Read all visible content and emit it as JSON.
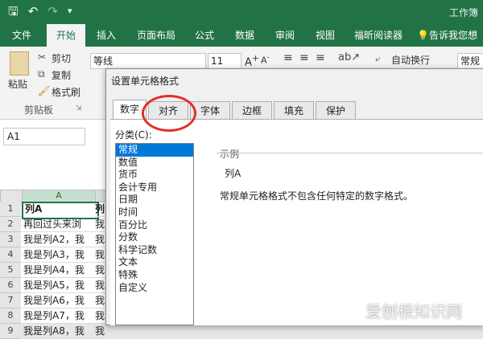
{
  "quick_access": {
    "save": "🖫",
    "undo": "↶",
    "redo": "↷",
    "more": "▾"
  },
  "window_title": "工作簿",
  "ribbon_tabs": [
    "文件",
    "开始",
    "插入",
    "页面布局",
    "公式",
    "数据",
    "审阅",
    "视图",
    "福昕阅读器",
    "告诉我您想"
  ],
  "active_tab": "开始",
  "ribbon": {
    "paste_label": "粘贴",
    "cut_label": "剪切",
    "copy_label": "复制",
    "format_painter_label": "格式刷",
    "clipboard_group": "剪贴板",
    "font_name": "等线",
    "font_size": "11",
    "wrap_text": "自动换行",
    "number_format": "常规"
  },
  "name_box": "A1",
  "column_header": "A",
  "rows": [
    {
      "num": "1",
      "a": "列A",
      "b": "列"
    },
    {
      "num": "2",
      "a": "再回过头来浏",
      "b": "我"
    },
    {
      "num": "3",
      "a": "我是列A2，我",
      "b": "我"
    },
    {
      "num": "4",
      "a": "我是列A3，我",
      "b": "我"
    },
    {
      "num": "5",
      "a": "我是列A4，我",
      "b": "我"
    },
    {
      "num": "6",
      "a": "我是列A5，我",
      "b": "我"
    },
    {
      "num": "7",
      "a": "我是列A6，我",
      "b": "我"
    },
    {
      "num": "8",
      "a": "我是列A7，我",
      "b": "我"
    },
    {
      "num": "9",
      "a": "我是列A8，我",
      "b": "我"
    }
  ],
  "dialog": {
    "title": "设置单元格格式",
    "tabs": [
      "数字",
      "对齐",
      "字体",
      "边框",
      "填充",
      "保护"
    ],
    "category_label": "分类(C):",
    "categories": [
      "常规",
      "数值",
      "货币",
      "会计专用",
      "日期",
      "时间",
      "百分比",
      "分数",
      "科学记数",
      "文本",
      "特殊",
      "自定义"
    ],
    "selected_category": "常规",
    "sample_label": "示例",
    "sample_value": "列A",
    "description": "常规单元格格式不包含任何特定的数字格式。"
  },
  "watermark": "爱刨根知识网"
}
